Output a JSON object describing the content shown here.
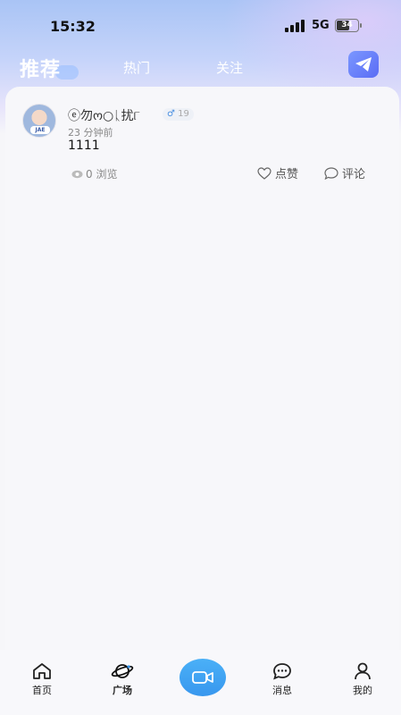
{
  "status_bar": {
    "time": "15:32",
    "network": "5G",
    "battery": "34"
  },
  "tabs": {
    "recommend": "推荐",
    "hot": "热门",
    "follow": "关注"
  },
  "post": {
    "username": "ⓔ勿ო○ᚳ扰୮",
    "gender_symbol": "♂",
    "age": "19",
    "time_ago": "23 分钟前",
    "content": "1111",
    "views": "0 浏览",
    "like_label": "点赞",
    "comment_label": "评论",
    "avatar_badge": "JAE"
  },
  "bottom_nav": {
    "home": "首页",
    "square": "广场",
    "messages": "消息",
    "me": "我的"
  },
  "colors": {
    "accent": "#3897ee",
    "gender": "#4a90e2"
  }
}
